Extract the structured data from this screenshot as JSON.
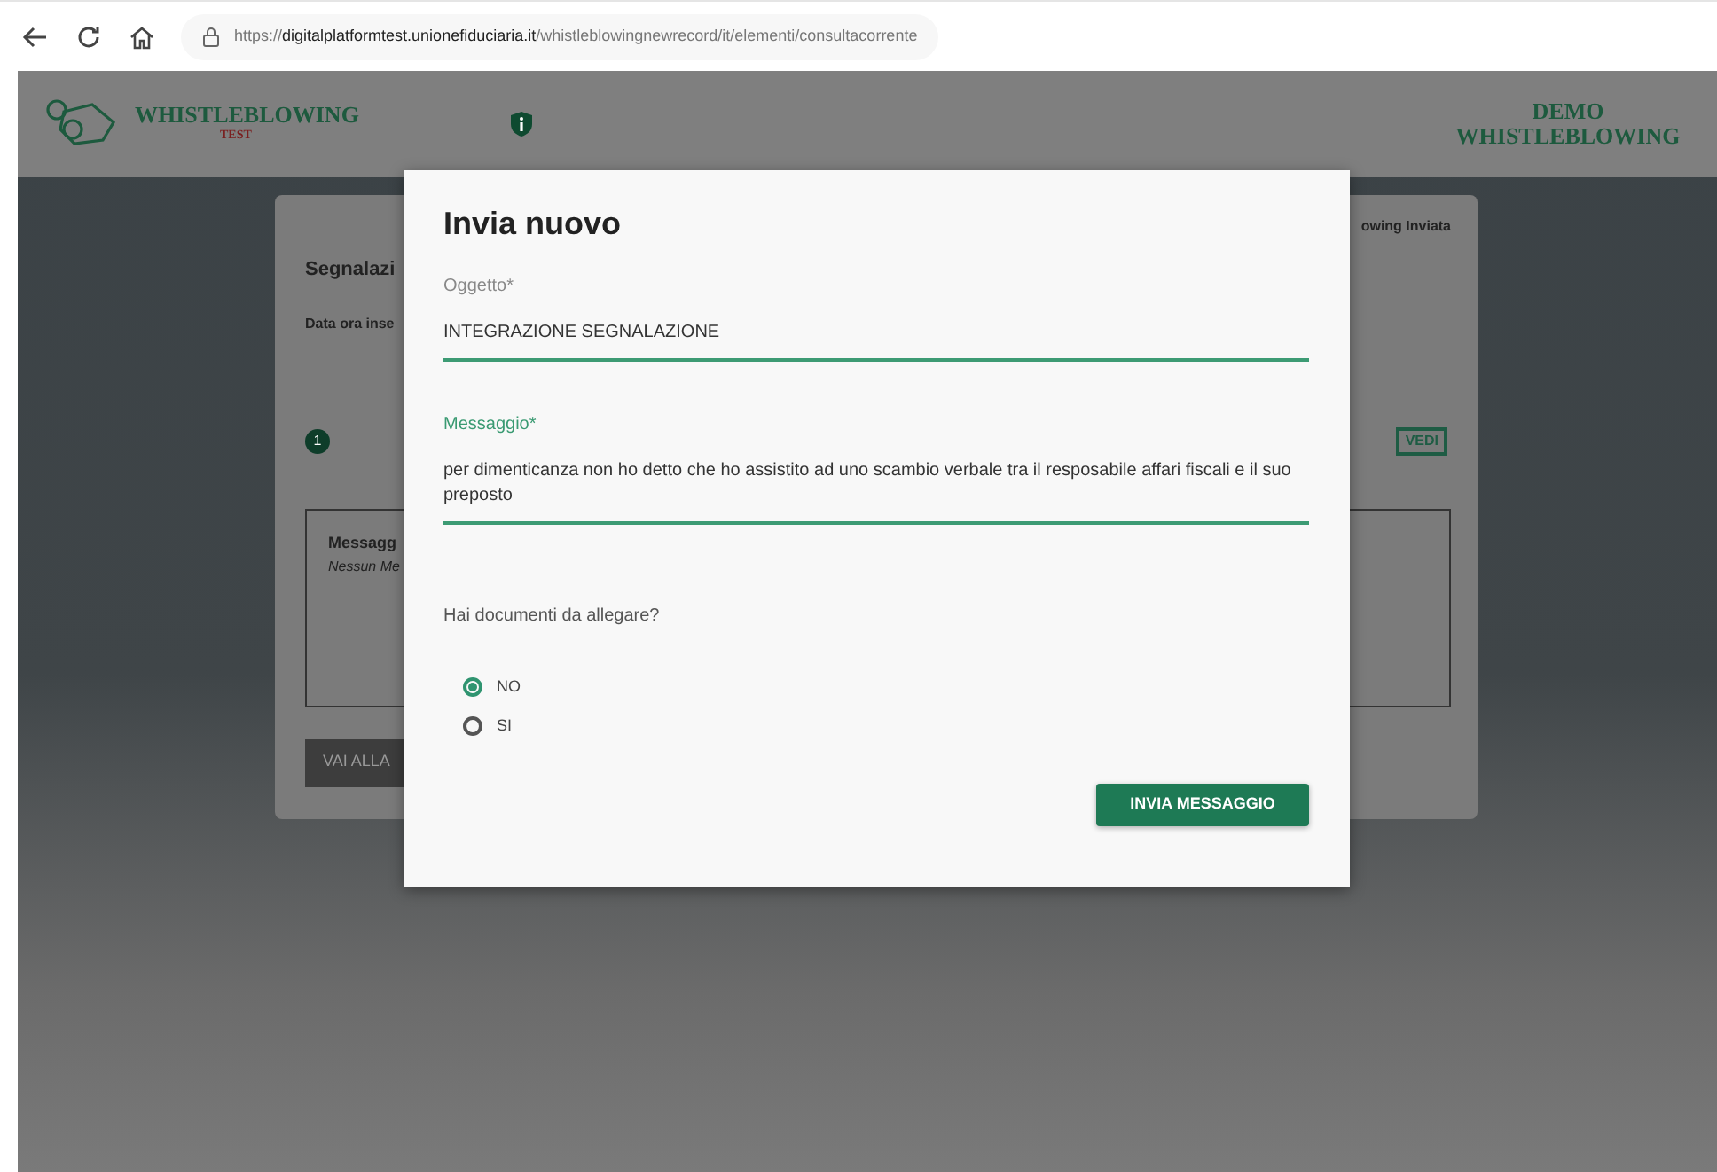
{
  "browser": {
    "url": {
      "scheme": "https://",
      "host": "digitalplatformtest.unionefiduciaria.it",
      "path": "/whistleblowingnewrecord/it/elementi/consultacorrente"
    }
  },
  "header": {
    "logo_title": "WHISTLEBLOWING",
    "logo_subtitle": "TEST",
    "app_title": "DEMO WHISTLEBLOWING"
  },
  "background_card": {
    "title": "Segnalazi",
    "date_label": "Data ora inse",
    "status_tab": "owing Inviata",
    "step_number": "1",
    "view_button": "VEDI",
    "messages_title": "Messagg",
    "messages_empty": "Nessun Me",
    "back_button": "VAI ALLA"
  },
  "modal": {
    "title": "Invia nuovo",
    "fields": [
      {
        "label": "Oggetto*",
        "value": "INTEGRAZIONE SEGNALAZIONE",
        "focused": false
      },
      {
        "label": "Messaggio*",
        "value": "per dimenticanza non ho detto che ho assistito ad uno scambio verbale tra il resposabile affari fiscali e il suo preposto",
        "focused": true
      }
    ],
    "question": "Hai documenti da allegare?",
    "options": [
      {
        "label": "NO",
        "selected": true
      },
      {
        "label": "SI",
        "selected": false
      }
    ],
    "submit": "INVIA MESSAGGIO"
  }
}
